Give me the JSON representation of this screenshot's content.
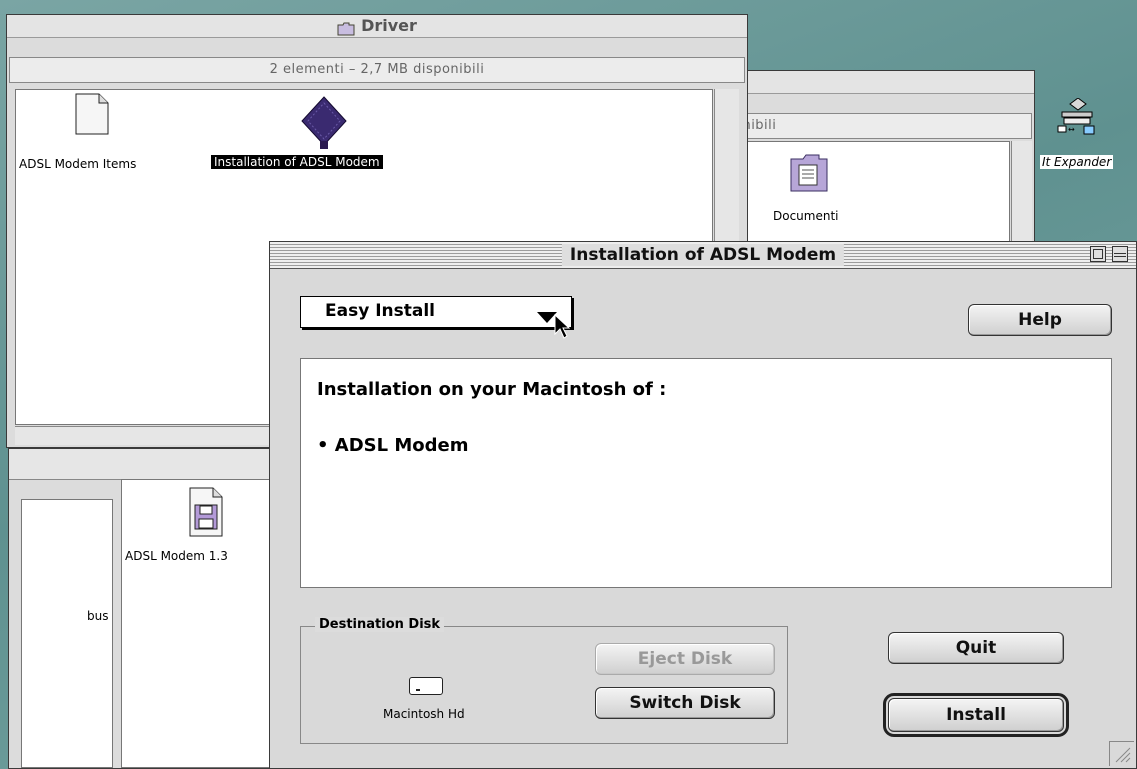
{
  "driver_window": {
    "title": "Driver",
    "info": "2 elementi – 2,7 MB disponibili",
    "items": [
      {
        "label": "ADSL Modem Items"
      },
      {
        "label": "Installation of ADSL Modem"
      }
    ]
  },
  "back_window": {
    "info_partial": "onibili",
    "folder_label": "Documenti"
  },
  "desktop": {
    "expander_label": "It Expander"
  },
  "disk_window": {
    "item_label": "ADSL Modem 1.3",
    "left_label": "bus"
  },
  "installer": {
    "title": "Installation of ADSL Modem",
    "mode_popup": "Easy Install",
    "help_label": "Help",
    "description_heading": "Installation on your Macintosh of :",
    "items": [
      "• ADSL Modem"
    ],
    "destination_group": "Destination Disk",
    "disk_name": "Macintosh Hd",
    "eject_label": "Eject Disk",
    "switch_label": "Switch Disk",
    "quit_label": "Quit",
    "install_label": "Install"
  }
}
